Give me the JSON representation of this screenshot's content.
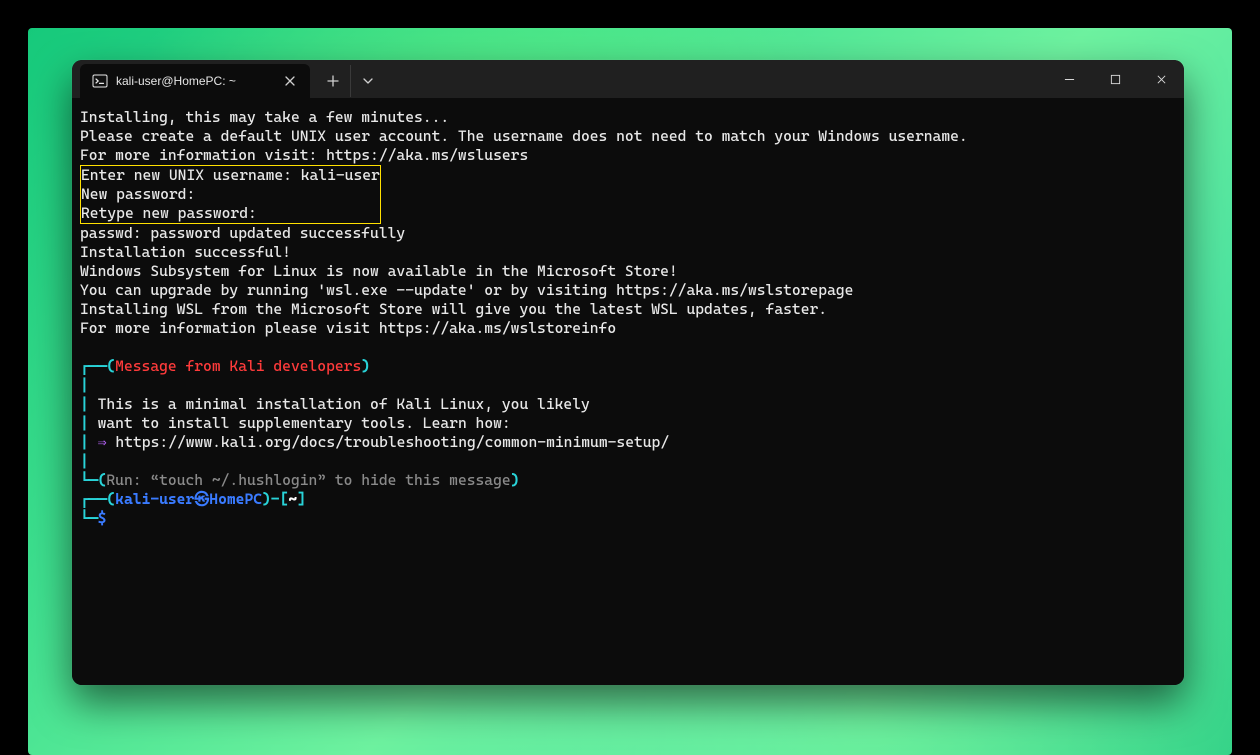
{
  "tab": {
    "title": "kali-user@HomePC: ~"
  },
  "lines": {
    "l1": "Installing, this may take a few minutes...",
    "l2": "Please create a default UNIX user account. The username does not need to match your Windows username.",
    "l3": "For more information visit: https://aka.ms/wslusers",
    "box1": "Enter new UNIX username: kali-user",
    "box2": "New password:",
    "box3": "Retype new password:",
    "l4": "passwd: password updated successfully",
    "l5": "Installation successful!",
    "l6": "Windows Subsystem for Linux is now available in the Microsoft Store!",
    "l7": "You can upgrade by running 'wsl.exe --update' or by visiting https://aka.ms/wslstorepage",
    "l8": "Installing WSL from the Microsoft Store will give you the latest WSL updates, faster.",
    "l9": "For more information please visit https://aka.ms/wslstoreinfo",
    "msg_title": "Message from Kali developers",
    "msg1": "This is a minimal installation of Kali Linux, you likely",
    "msg2": "want to install supplementary tools. Learn how:",
    "msg3_arrow": "⇒",
    "msg3_url": "https://www.kali.org/docs/troubleshooting/common-minimum-setup/",
    "hush": "Run: “touch ~/.hushlogin” to hide this message",
    "prompt_user": "kali-user",
    "prompt_host": "HomePC",
    "prompt_sep": "㉿",
    "prompt_path": "~",
    "prompt_symbol": "$"
  }
}
